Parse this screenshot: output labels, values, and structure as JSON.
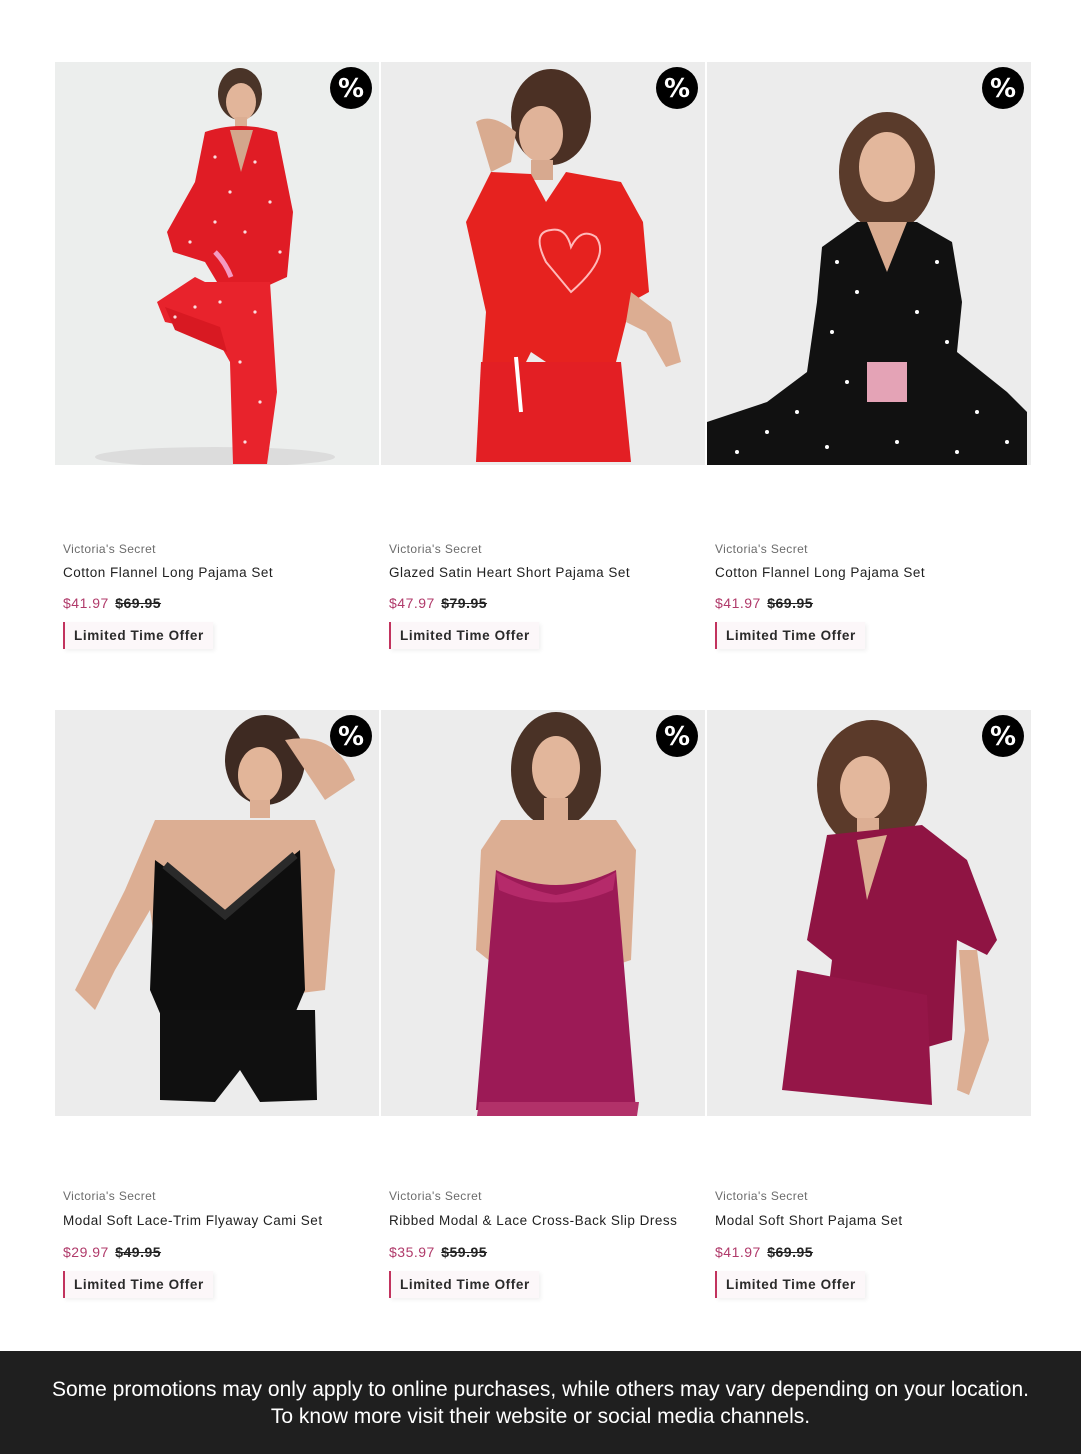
{
  "products": [
    {
      "brand": "Victoria's Secret",
      "name": "Cotton Flannel Long Pajama Set",
      "sale_price": "$41.97",
      "original_price": "$69.95",
      "offer": "Limited Time Offer",
      "badge": "%",
      "image_alt": "red polka dot long pajama set"
    },
    {
      "brand": "Victoria's Secret",
      "name": "Glazed Satin Heart Short Pajama Set",
      "sale_price": "$47.97",
      "original_price": "$79.95",
      "offer": "Limited Time Offer",
      "badge": "%",
      "image_alt": "red satin short pajama set"
    },
    {
      "brand": "Victoria's Secret",
      "name": "Cotton Flannel Long Pajama Set",
      "sale_price": "$41.97",
      "original_price": "$69.95",
      "offer": "Limited Time Offer",
      "badge": "%",
      "image_alt": "black polka dot long pajama set"
    },
    {
      "brand": "Victoria's Secret",
      "name": "Modal Soft Lace-Trim Flyaway Cami Set",
      "sale_price": "$29.97",
      "original_price": "$49.95",
      "offer": "Limited Time Offer",
      "badge": "%",
      "image_alt": "black lace cami set"
    },
    {
      "brand": "Victoria's Secret",
      "name": "Ribbed Modal & Lace Cross-Back Slip Dress",
      "sale_price": "$35.97",
      "original_price": "$59.95",
      "offer": "Limited Time Offer",
      "badge": "%",
      "image_alt": "berry slip dress"
    },
    {
      "brand": "Victoria's Secret",
      "name": "Modal Soft Short Pajama Set",
      "sale_price": "$41.97",
      "original_price": "$69.95",
      "offer": "Limited Time Offer",
      "badge": "%",
      "image_alt": "berry short pajama set"
    }
  ],
  "footer": {
    "line1": "Some promotions may only apply to online purchases, while others may vary depending on your location.",
    "line2": "To know more visit their website or social media channels."
  },
  "colors": {
    "sale_price": "#b03a6a",
    "offer_accent": "#c2335e",
    "footer_bg": "#1f1f1f",
    "badge": "#000000"
  }
}
